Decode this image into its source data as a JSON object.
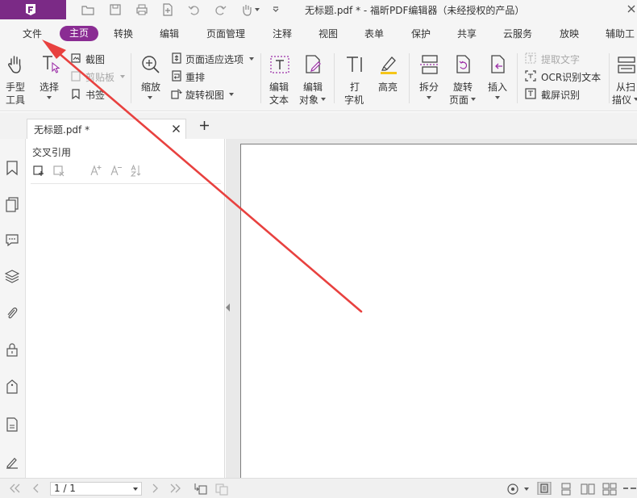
{
  "window": {
    "title": "无标题.pdf * - 福昕PDF编辑器（未经授权的产品）"
  },
  "menu": {
    "file": "文件",
    "home": "主页",
    "items": [
      "转换",
      "编辑",
      "页面管理",
      "注释",
      "视图",
      "表单",
      "保护",
      "共享",
      "云服务",
      "放映",
      "辅助工"
    ]
  },
  "ribbon": {
    "hand_tool": [
      "手型",
      "工具"
    ],
    "select": "选择",
    "screenshot": "截图",
    "clipboard": "剪贴板",
    "bookmark": "书签",
    "zoom": "缩放",
    "fit_page": "页面适应选项",
    "reflow": "重排",
    "rotate_view": "旋转视图",
    "edit_text": [
      "编辑",
      "文本"
    ],
    "edit_object": [
      "编辑",
      "对象"
    ],
    "typewriter": [
      "打",
      "字机"
    ],
    "highlight": "高亮",
    "split": "拆分",
    "rotate_page": [
      "旋转",
      "页面"
    ],
    "insert": "插入",
    "extract_text": "提取文字",
    "ocr": "OCR识别文本",
    "screen_ocr": "截屏识别",
    "scan": [
      "从扫",
      "描仪"
    ]
  },
  "tabs": {
    "doc_tab": "无标题.pdf *",
    "new_tab": "+"
  },
  "panel": {
    "title": "交叉引用"
  },
  "status": {
    "page_value": "1 / 1"
  },
  "colors": {
    "brand": "#7b2a86",
    "home_tab": "#8a2c93",
    "arrow": "#e8413f"
  }
}
